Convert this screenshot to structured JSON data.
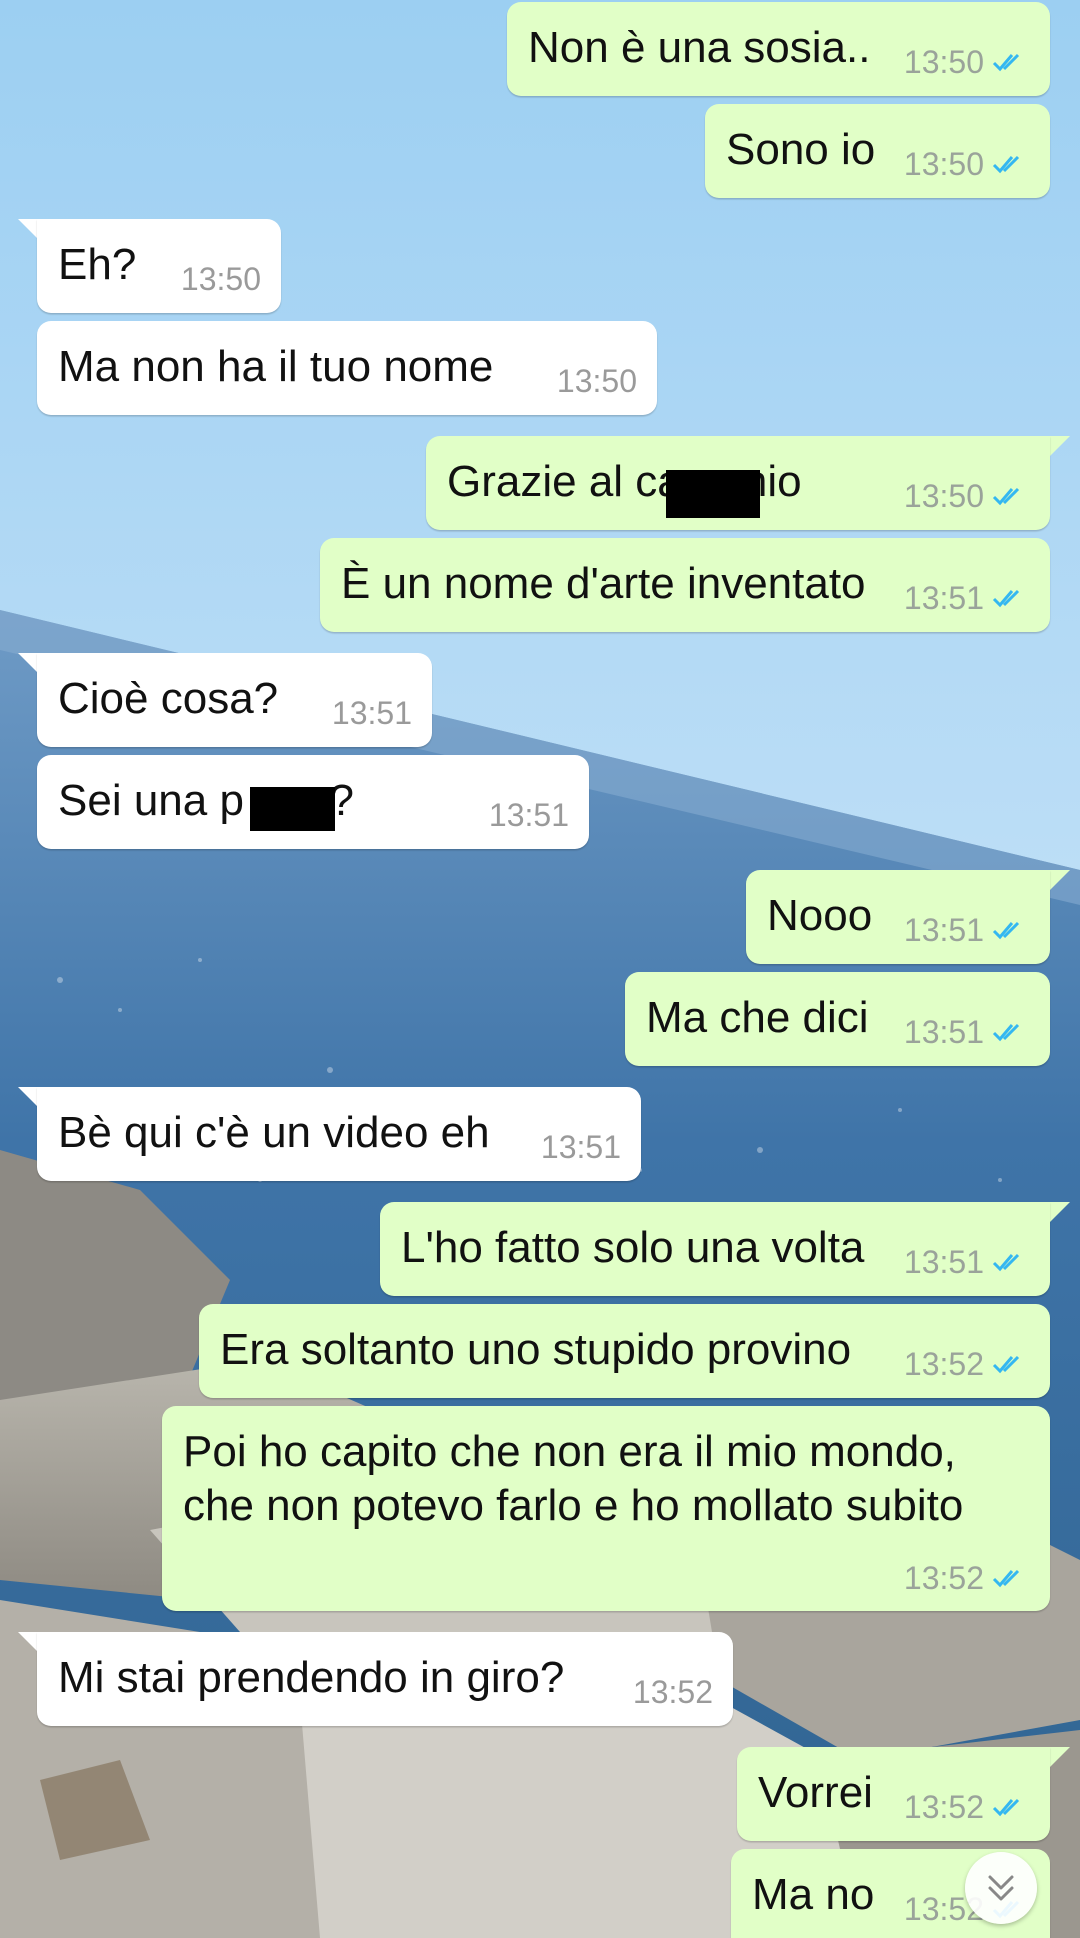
{
  "colors": {
    "outgoing_bubble": "#e1ffc7",
    "incoming_bubble": "#ffffff",
    "read_ticks": "#34b7f1",
    "timestamp": "#9a9a9a"
  },
  "messages": [
    {
      "dir": "out",
      "text": "Non è una sosia..",
      "time": "13:50",
      "status": "read"
    },
    {
      "dir": "out",
      "text": "Sono io",
      "time": "13:50",
      "status": "read"
    },
    {
      "dir": "in",
      "text": "Eh?",
      "time": "13:50"
    },
    {
      "dir": "in",
      "text": "Ma non ha il tuo nome",
      "time": "13:50"
    },
    {
      "dir": "out",
      "text": "Grazie al ca      genio",
      "time": "13:50",
      "status": "read",
      "redacted": true
    },
    {
      "dir": "out",
      "text": "È un nome d'arte inventato",
      "time": "13:51",
      "status": "read"
    },
    {
      "dir": "in",
      "text": "Cioè cosa?",
      "time": "13:51"
    },
    {
      "dir": "in",
      "text": "Sei una p      star?",
      "time": "13:51",
      "redacted": true
    },
    {
      "dir": "out",
      "text": "Nooo",
      "time": "13:51",
      "status": "read"
    },
    {
      "dir": "out",
      "text": "Ma che dici",
      "time": "13:51",
      "status": "read"
    },
    {
      "dir": "in",
      "text": "Bè qui c'è un video eh",
      "time": "13:51"
    },
    {
      "dir": "out",
      "text": "L'ho fatto solo una volta",
      "time": "13:51",
      "status": "read"
    },
    {
      "dir": "out",
      "text": "Era soltanto uno stupido provino",
      "time": "13:52",
      "status": "read"
    },
    {
      "dir": "out",
      "lines": [
        "Poi ho capito che non era il mio mondo,",
        "che non potevo farlo e ho mollato subito"
      ],
      "time": "13:52",
      "status": "read"
    },
    {
      "dir": "in",
      "text": "Mi stai prendendo in giro?",
      "time": "13:52"
    },
    {
      "dir": "out",
      "text": "Vorrei",
      "time": "13:52",
      "status": "read"
    },
    {
      "dir": "out",
      "text": "Ma no",
      "time": "13:52",
      "status": "read"
    }
  ],
  "scroll_button": {
    "icon": "double-chevron-down-icon"
  }
}
